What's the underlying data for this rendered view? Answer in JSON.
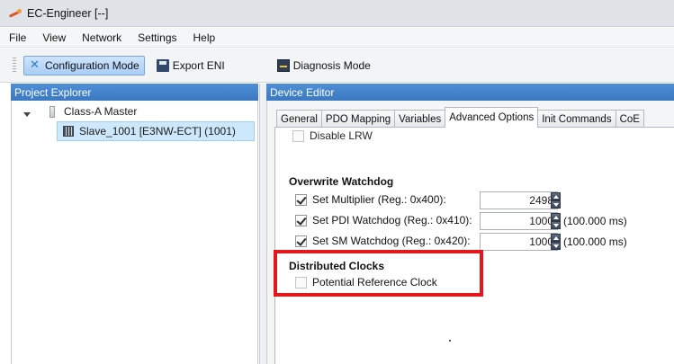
{
  "window": {
    "title": "EC-Engineer [--]"
  },
  "menu": [
    "File",
    "View",
    "Network",
    "Settings",
    "Help"
  ],
  "toolbar": {
    "configuration_mode": "Configuration Mode",
    "export_eni": "Export ENI",
    "diagnosis_mode": "Diagnosis Mode"
  },
  "project_explorer": {
    "header": "Project Explorer",
    "master": "Class-A Master",
    "slave": "Slave_1001 [E3NW-ECT] (1001)"
  },
  "device_editor": {
    "header": "Device Editor",
    "tabs": [
      "General",
      "PDO Mapping",
      "Variables",
      "Advanced Options",
      "Init Commands",
      "CoE"
    ],
    "selected_tab": "Advanced Options",
    "disable_lrw": {
      "label": "Disable LRW",
      "checked": false
    },
    "watchdog": {
      "title": "Overwrite Watchdog",
      "multiplier": {
        "label": "Set Multiplier (Reg.: 0x400):",
        "value": "2498",
        "checked": true
      },
      "pdi": {
        "label": "Set PDI Watchdog (Reg.: 0x410):",
        "value": "1000",
        "unit": "(100.000 ms)",
        "checked": true
      },
      "sm": {
        "label": "Set SM Watchdog (Reg.: 0x420):",
        "value": "1000",
        "unit": "(100.000 ms)",
        "checked": true
      }
    },
    "distributed_clocks": {
      "title": "Distributed Clocks",
      "potential_reference": {
        "label": "Potential Reference Clock",
        "checked": false
      }
    }
  },
  "colors": {
    "panel_header": "#3a78c3",
    "selection": "#cde8fb",
    "highlight": "#e4161e"
  }
}
